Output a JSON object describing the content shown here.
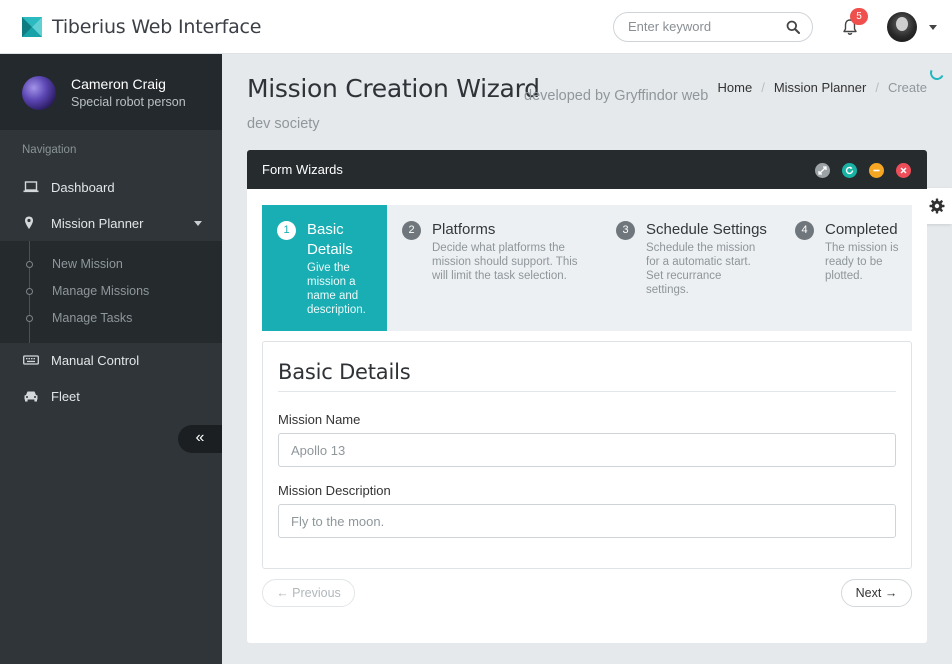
{
  "app": {
    "title": "Tiberius Web Interface"
  },
  "search": {
    "placeholder": "Enter keyword"
  },
  "notifications": {
    "count": "5"
  },
  "user": {
    "name": "Cameron Craig",
    "role": "Special robot person"
  },
  "sidebar": {
    "heading": "Navigation",
    "items": [
      {
        "label": "Dashboard",
        "icon": "laptop-icon"
      },
      {
        "label": "Mission Planner",
        "icon": "map-pin-icon"
      },
      {
        "label": "Manual Control",
        "icon": "keyboard-icon"
      },
      {
        "label": "Fleet",
        "icon": "car-icon"
      }
    ],
    "subitems": [
      {
        "label": "New Mission"
      },
      {
        "label": "Manage Missions"
      },
      {
        "label": "Manage Tasks"
      }
    ],
    "collapse_label": "«"
  },
  "page": {
    "title": "Mission Creation Wizard",
    "subtitle": "developed by Gryffindor web dev society"
  },
  "breadcrumb": [
    "Home",
    "Mission Planner",
    "Create"
  ],
  "panel": {
    "title": "Form Wizards"
  },
  "steps": [
    {
      "number": "1",
      "title": "Basic Details",
      "description": "Give the mission a name and description.",
      "active": true
    },
    {
      "number": "2",
      "title": "Platforms",
      "description": "Decide what platforms the mission should support. This will limit the task selection.",
      "active": false
    },
    {
      "number": "3",
      "title": "Schedule Settings",
      "description": "Schedule the mission for a automatic start. Set recurrance settings.",
      "active": false
    },
    {
      "number": "4",
      "title": "Completed",
      "description": "The mission is ready to be plotted.",
      "active": false
    }
  ],
  "form": {
    "section_title": "Basic Details",
    "fields": [
      {
        "label": "Mission Name",
        "value": "",
        "placeholder": "Apollo 13"
      },
      {
        "label": "Mission Description",
        "value": "",
        "placeholder": "Fly to the moon."
      }
    ]
  },
  "buttons": {
    "previous": "← Previous",
    "next": "Next →"
  },
  "colors": {
    "accent": "#18aeb3",
    "sidebar": "#2f3538",
    "panel_header": "#262b2e",
    "badge": "#f0504d"
  }
}
